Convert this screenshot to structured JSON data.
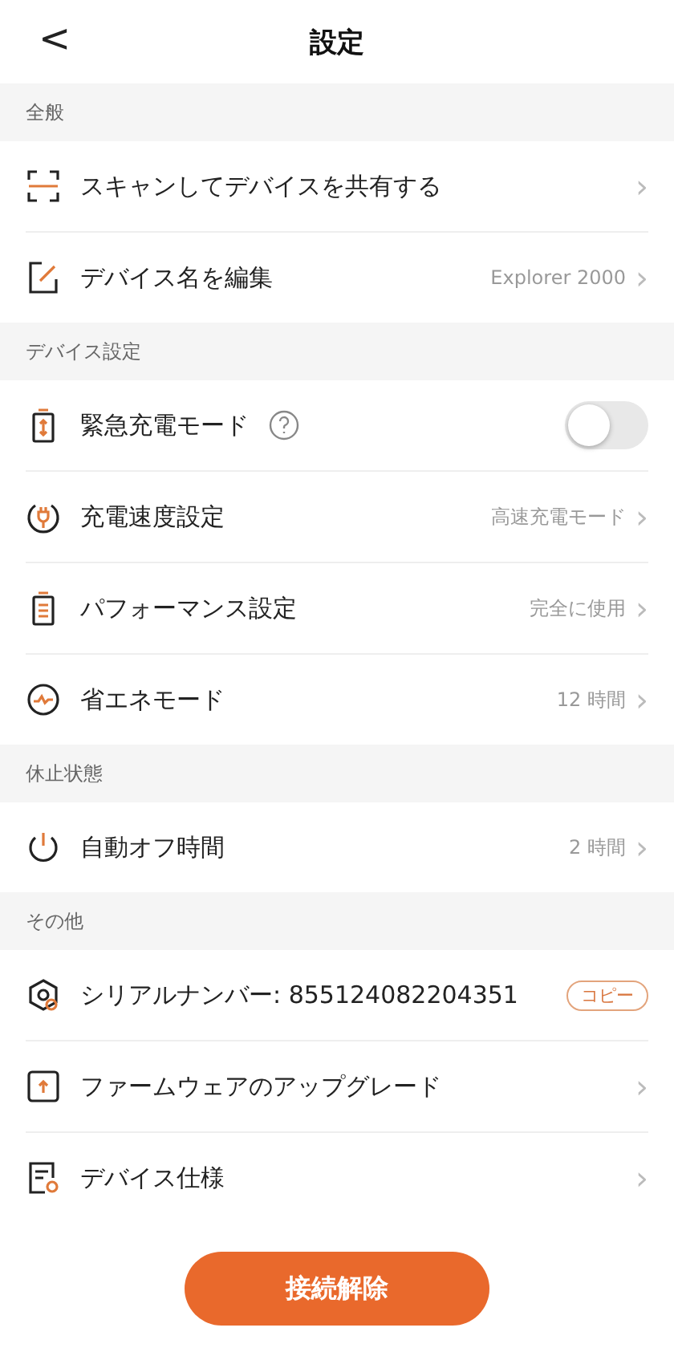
{
  "header": {
    "back": "<",
    "title": "設定"
  },
  "sections": [
    {
      "title": "全般",
      "rows": [
        {
          "kind": "link",
          "label": "スキャンしてデバイスを共有する",
          "chevron": "›"
        },
        {
          "kind": "link",
          "label": "デバイス名を編集",
          "value": "Explorer 2000",
          "chevron": "›"
        }
      ]
    },
    {
      "title": "デバイス設定",
      "rows": [
        {
          "kind": "toggle",
          "label": "緊急充電モード",
          "help": true,
          "on": false
        },
        {
          "kind": "link",
          "label": "充電速度設定",
          "value": "高速充電モード",
          "chevron": "›"
        },
        {
          "kind": "link",
          "label": "パフォーマンス設定",
          "value": "完全に使用",
          "chevron": "›"
        },
        {
          "kind": "link",
          "label": "省エネモード",
          "value": "12 時間",
          "chevron": "›"
        }
      ]
    },
    {
      "title": "休止状態",
      "rows": [
        {
          "kind": "link",
          "label": "自動オフ時間",
          "value": "2 時間",
          "chevron": "›"
        }
      ]
    },
    {
      "title": "その他",
      "rows": [
        {
          "kind": "copy",
          "label": "シリアルナンバー: 855124082204351",
          "action": "コピー"
        },
        {
          "kind": "link",
          "label": "ファームウェアのアップグレード",
          "chevron": "›"
        },
        {
          "kind": "link",
          "label": "デバイス仕様",
          "chevron": "›"
        }
      ]
    }
  ],
  "disconnect": "接続解除"
}
